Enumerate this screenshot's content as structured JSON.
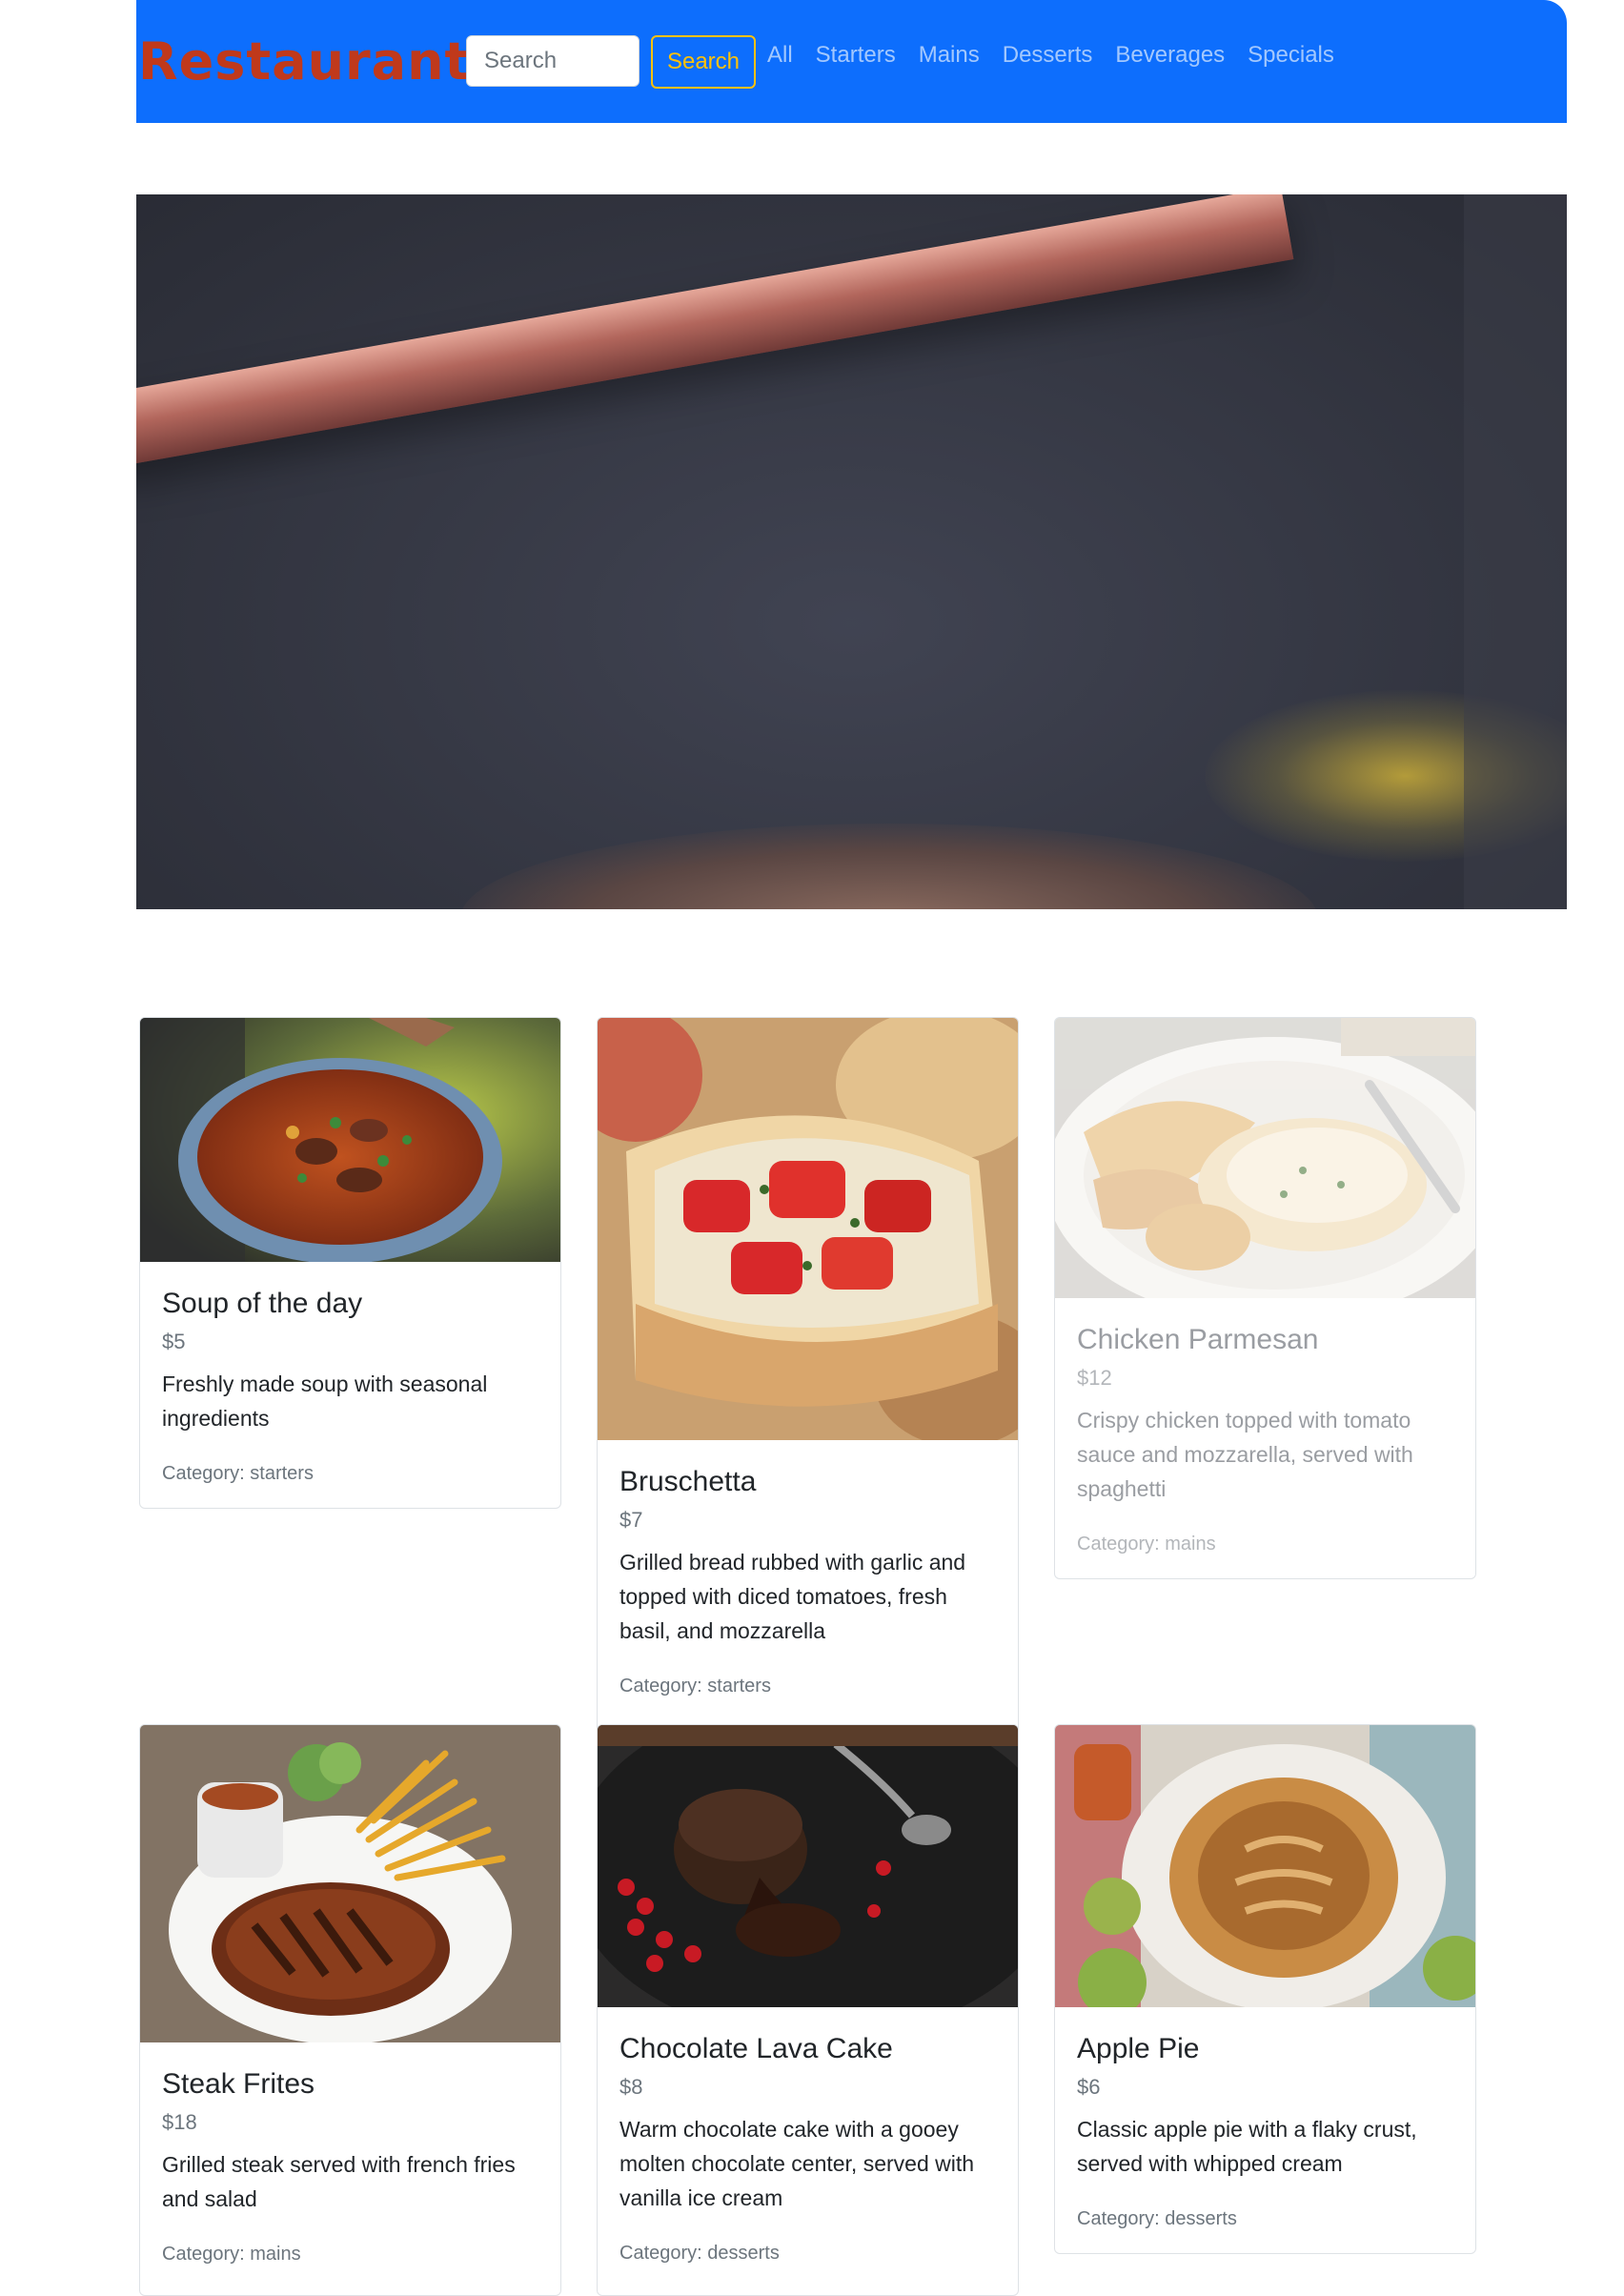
{
  "brand": {
    "name": "Restaurant",
    "color": "#c0391b"
  },
  "navbar": {
    "color": "#0d6efd",
    "search": {
      "placeholder": "Search",
      "button_label": "Search"
    },
    "links": [
      "All",
      "Starters",
      "Mains",
      "Desserts",
      "Beverages",
      "Specials"
    ]
  },
  "menu": {
    "items": [
      {
        "title": "Soup of the day",
        "price": "$5",
        "description": "Freshly made soup with seasonal ingredients",
        "category": "Category: starters",
        "image_icon": "soup-bowl-photo"
      },
      {
        "title": "Bruschetta",
        "price": "$7",
        "description": "Grilled bread rubbed with garlic and topped with diced tomatoes, fresh basil, and mozzarella",
        "category": "Category: starters",
        "image_icon": "bruschetta-photo"
      },
      {
        "title": "Chicken Parmesan",
        "price": "$12",
        "description": "Crispy chicken topped with tomato sauce and mozzarella, served with spaghetti",
        "category": "Category: mains",
        "image_icon": "chicken-parmesan-photo"
      },
      {
        "title": "Steak Frites",
        "price": "$18",
        "description": "Grilled steak served with french fries and salad",
        "category": "Category: mains",
        "image_icon": "steak-frites-photo"
      },
      {
        "title": "Chocolate Lava Cake",
        "price": "$8",
        "description": "Warm chocolate cake with a gooey molten chocolate center, served with vanilla ice cream",
        "category": "Category: desserts",
        "image_icon": "lava-cake-photo"
      },
      {
        "title": "Apple Pie",
        "price": "$6",
        "description": "Classic apple pie with a flaky crust, served with whipped cream",
        "category": "Category: desserts",
        "image_icon": "apple-pie-photo"
      }
    ]
  }
}
